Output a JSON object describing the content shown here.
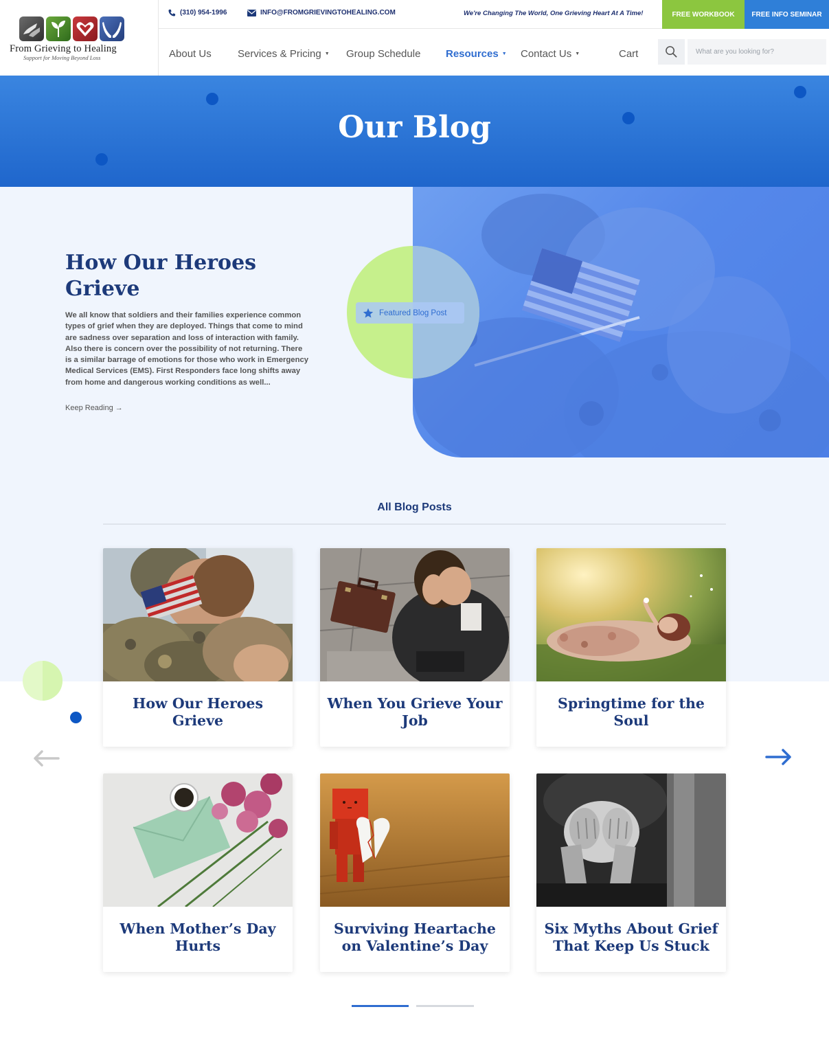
{
  "header": {
    "logo_name": "From Grieving to Healing",
    "logo_tagline": "Support for Moving Beyond Loss",
    "phone": "(310) 954-1996",
    "email": "INFO@FROMGRIEVINGTOHEALING.COM",
    "slogan": "We're Changing The World, One Grieving Heart At A Time!",
    "btn_workbook": "FREE WORKBOOK",
    "btn_seminar": "FREE INFO SEMINAR",
    "search_placeholder": "What are you looking for?",
    "nav": [
      {
        "label": "About Us"
      },
      {
        "label": "Services & Pricing"
      },
      {
        "label": "Group Schedule"
      },
      {
        "label": "Resources"
      },
      {
        "label": "Contact Us"
      },
      {
        "label": "Cart"
      }
    ]
  },
  "hero": {
    "title": "Our Blog"
  },
  "featured": {
    "title": "How Our Heroes Grieve",
    "excerpt": "We all know that soldiers and their families experience common types of grief when they are deployed. Things that come to mind are sadness over separation and loss of interaction with family. Also there is concern over the possibility of not returning. There is a similar barrage of emotions for those who work in Emergency Medical Services (EMS). First Responders face long shifts away from home and dangerous working conditions as well...",
    "link_label": "Keep Reading",
    "badge": "Featured Blog Post"
  },
  "all_posts": {
    "title": "All Blog Posts",
    "posts": [
      {
        "title": "How Our Heroes Grieve"
      },
      {
        "title": "When You Grieve Your Job"
      },
      {
        "title": "Springtime for the Soul"
      },
      {
        "title": "When Mother’s Day Hurts"
      },
      {
        "title": "Surviving Heartache on Valentine’s Day"
      },
      {
        "title": "Six Myths About Grief That Keep Us Stuck"
      }
    ]
  },
  "colors": {
    "brand_blue": "#2f7fd8",
    "brand_green": "#8cc63f",
    "navy": "#1d3a7a"
  }
}
